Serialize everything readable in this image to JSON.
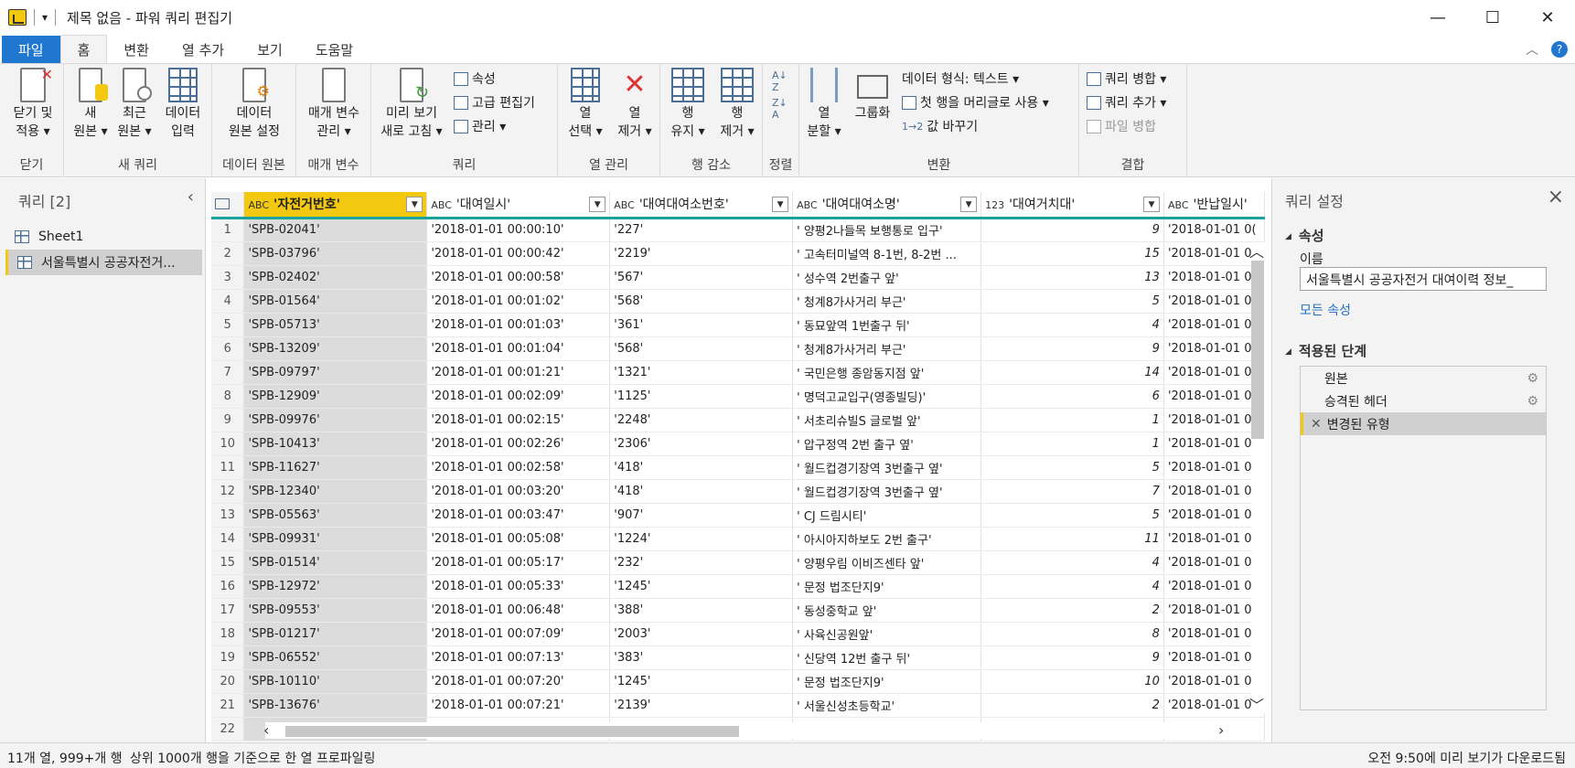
{
  "titlebar": {
    "title": "제목 없음 - 파워 쿼리 편집기",
    "quick_access": "▾",
    "minimize": "—",
    "maximize": "☐",
    "close": "✕"
  },
  "tabs": [
    "파일",
    "홈",
    "변환",
    "열 추가",
    "보기",
    "도움말"
  ],
  "ribbon": {
    "close_apply": [
      "닫기 및",
      "적용 ▾"
    ],
    "group_close": "닫기",
    "new_source": [
      "새",
      "원본 ▾"
    ],
    "recent_source": [
      "최근",
      "원본 ▾"
    ],
    "enter_data": [
      "데이터",
      "입력"
    ],
    "group_new_query": "새 쿼리",
    "data_source_settings": [
      "데이터",
      "원본 설정"
    ],
    "group_data_source": "데이터 원본",
    "manage_params": [
      "매개 변수",
      "관리 ▾"
    ],
    "group_params": "매개 변수",
    "refresh_preview": [
      "미리 보기",
      "새로 고침 ▾"
    ],
    "properties": "속성",
    "advanced_editor": "고급 편집기",
    "manage": "관리 ▾",
    "group_query": "쿼리",
    "choose_columns": [
      "열",
      "선택 ▾"
    ],
    "remove_columns": [
      "열",
      "제거 ▾"
    ],
    "group_manage_columns": "열 관리",
    "keep_rows": [
      "행",
      "유지 ▾"
    ],
    "remove_rows": [
      "행",
      "제거 ▾"
    ],
    "group_reduce_rows": "행 감소",
    "group_sort": "정렬",
    "split_column": [
      "열",
      "분할 ▾"
    ],
    "group_by": "그룹화",
    "data_type": "데이터 형식: 텍스트 ▾",
    "first_row_headers": "첫 행을 머리글로 사용 ▾",
    "replace_values": "값 바꾸기",
    "group_transform": "변환",
    "merge_queries": "쿼리 병합 ▾",
    "append_queries": "쿼리 추가 ▾",
    "combine_files": "파일 병합",
    "group_combine": "결합"
  },
  "left_pane": {
    "title": "쿼리 [2]",
    "queries": [
      "Sheet1",
      "서울특별시 공공자전거..."
    ]
  },
  "grid": {
    "columns": [
      {
        "type": "ABC",
        "name": "'자전거번호'"
      },
      {
        "type": "ABC",
        "name": "'대여일시'"
      },
      {
        "type": "ABC",
        "name": "'대여대여소번호'"
      },
      {
        "type": "ABC",
        "name": "'대여대여소명'"
      },
      {
        "type": "123",
        "name": "'대여거치대'"
      },
      {
        "type": "ABC",
        "name": "'반납일시'"
      }
    ],
    "rows": [
      [
        "1",
        "'SPB-02041'",
        "'2018-01-01 00:00:10'",
        "'227'",
        "' 양평2나들목 보행통로 입구'",
        "9",
        "'2018-01-01 0("
      ],
      [
        "2",
        "'SPB-03796'",
        "'2018-01-01 00:00:42'",
        "'2219'",
        "' 고속터미널역 8-1번, 8-2번 ...",
        "15",
        "'2018-01-01 0("
      ],
      [
        "3",
        "'SPB-02402'",
        "'2018-01-01 00:00:58'",
        "'567'",
        "' 성수역 2번출구 앞'",
        "13",
        "'2018-01-01 0("
      ],
      [
        "4",
        "'SPB-01564'",
        "'2018-01-01 00:01:02'",
        "'568'",
        "' 청계8가사거리 부근'",
        "5",
        "'2018-01-01 0("
      ],
      [
        "5",
        "'SPB-05713'",
        "'2018-01-01 00:01:03'",
        "'361'",
        "' 동묘앞역 1번출구 뒤'",
        "4",
        "'2018-01-01 0("
      ],
      [
        "6",
        "'SPB-13209'",
        "'2018-01-01 00:01:04'",
        "'568'",
        "' 청계8가사거리 부근'",
        "9",
        "'2018-01-01 0("
      ],
      [
        "7",
        "'SPB-09797'",
        "'2018-01-01 00:01:21'",
        "'1321'",
        "' 국민은행 종암동지점 앞'",
        "14",
        "'2018-01-01 0("
      ],
      [
        "8",
        "'SPB-12909'",
        "'2018-01-01 00:02:09'",
        "'1125'",
        "' 명덕고교입구(영종빌딩)'",
        "6",
        "'2018-01-01 0("
      ],
      [
        "9",
        "'SPB-09976'",
        "'2018-01-01 00:02:15'",
        "'2248'",
        "' 서초리슈빌S 글로벌 앞'",
        "1",
        "'2018-01-01 0("
      ],
      [
        "10",
        "'SPB-10413'",
        "'2018-01-01 00:02:26'",
        "'2306'",
        "' 압구정역 2번 출구 옆'",
        "1",
        "'2018-01-01 0("
      ],
      [
        "11",
        "'SPB-11627'",
        "'2018-01-01 00:02:58'",
        "'418'",
        "' 월드컵경기장역 3번출구 옆'",
        "5",
        "'2018-01-01 0("
      ],
      [
        "12",
        "'SPB-12340'",
        "'2018-01-01 00:03:20'",
        "'418'",
        "' 월드컵경기장역 3번출구 옆'",
        "7",
        "'2018-01-01 0("
      ],
      [
        "13",
        "'SPB-05563'",
        "'2018-01-01 00:03:47'",
        "'907'",
        "' CJ 드림시티'",
        "5",
        "'2018-01-01 0("
      ],
      [
        "14",
        "'SPB-09931'",
        "'2018-01-01 00:05:08'",
        "'1224'",
        "' 아시아지하보도 2번 출구'",
        "11",
        "'2018-01-01 0("
      ],
      [
        "15",
        "'SPB-01514'",
        "'2018-01-01 00:05:17'",
        "'232'",
        "' 양평우림 이비즈센타 앞'",
        "4",
        "'2018-01-01 0("
      ],
      [
        "16",
        "'SPB-12972'",
        "'2018-01-01 00:05:33'",
        "'1245'",
        "' 문정 법조단지9'",
        "4",
        "'2018-01-01 0("
      ],
      [
        "17",
        "'SPB-09553'",
        "'2018-01-01 00:06:48'",
        "'388'",
        "' 동성중학교 앞'",
        "2",
        "'2018-01-01 0:"
      ],
      [
        "18",
        "'SPB-01217'",
        "'2018-01-01 00:07:09'",
        "'2003'",
        "' 사육신공원앞'",
        "8",
        "'2018-01-01 0("
      ],
      [
        "19",
        "'SPB-06552'",
        "'2018-01-01 00:07:13'",
        "'383'",
        "' 신당역 12번 출구 뒤'",
        "9",
        "'2018-01-01 0("
      ],
      [
        "20",
        "'SPB-10110'",
        "'2018-01-01 00:07:20'",
        "'1245'",
        "' 문정 법조단지9'",
        "10",
        "'2018-01-01 0("
      ],
      [
        "21",
        "'SPB-13676'",
        "'2018-01-01 00:07:21'",
        "'2139'",
        "' 서울신성초등학교'",
        "2",
        "'2018-01-01 0:"
      ],
      [
        "22",
        "",
        "",
        "",
        "",
        "",
        ""
      ]
    ]
  },
  "right_pane": {
    "title": "쿼리 설정",
    "props_section": "속성",
    "name_label": "이름",
    "name_value": "서울특별시 공공자전거 대여이력 정보_",
    "all_props": "모든 속성",
    "steps_section": "적용된 단계",
    "steps": [
      "원본",
      "승격된 헤더",
      "변경된 유형"
    ]
  },
  "statusbar": {
    "left": "11개 열, 999+개 행",
    "profiling": "상위 1000개 행을 기준으로 한 열 프로파일링",
    "right": "오전 9:50에 미리 보기가 다운로드됨"
  },
  "colors": {
    "accent": "#1f77d0",
    "selection": "#f2c811",
    "header_line": "#1aa39a"
  }
}
